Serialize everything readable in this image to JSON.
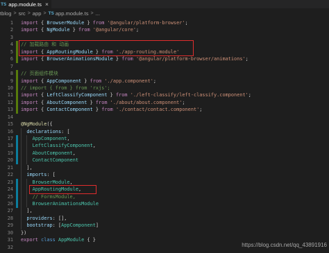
{
  "tab": {
    "icon": "TS",
    "filename": "app.module.ts",
    "close": "×"
  },
  "breadcrumb": {
    "items": [
      "tblog",
      "src",
      "app",
      "app.module.ts",
      "..."
    ],
    "file_icon": "TS",
    "separator": ">"
  },
  "editor": {
    "lines": [
      {
        "n": "1",
        "tokens": [
          {
            "t": "import",
            "k": "kw"
          },
          {
            "t": " { ",
            "k": "p"
          },
          {
            "t": "BrowserModule",
            "k": "v"
          },
          {
            "t": " } ",
            "k": "p"
          },
          {
            "t": "from",
            "k": "kw"
          },
          {
            "t": " ",
            "k": "p"
          },
          {
            "t": "'@angular/platform-browser'",
            "k": "s"
          },
          {
            "t": ";",
            "k": "p"
          }
        ]
      },
      {
        "n": "2",
        "tokens": [
          {
            "t": "import",
            "k": "kw"
          },
          {
            "t": " { ",
            "k": "p"
          },
          {
            "t": "NgModule",
            "k": "v"
          },
          {
            "t": " } ",
            "k": "p"
          },
          {
            "t": "from",
            "k": "kw"
          },
          {
            "t": " ",
            "k": "p"
          },
          {
            "t": "'@angular/core'",
            "k": "s"
          },
          {
            "t": ";",
            "k": "p"
          }
        ]
      },
      {
        "n": "3",
        "tokens": []
      },
      {
        "n": "4",
        "tokens": [
          {
            "t": "// 加载路由 和 动画",
            "k": "c"
          }
        ]
      },
      {
        "n": "5",
        "tokens": [
          {
            "t": "import",
            "k": "kw"
          },
          {
            "t": " { ",
            "k": "p"
          },
          {
            "t": "AppRoutingModule",
            "k": "v"
          },
          {
            "t": " } ",
            "k": "p"
          },
          {
            "t": "from",
            "k": "kw"
          },
          {
            "t": " ",
            "k": "p"
          },
          {
            "t": "'./app-routing.module'",
            "k": "s"
          }
        ]
      },
      {
        "n": "6",
        "tokens": [
          {
            "t": "import",
            "k": "kw"
          },
          {
            "t": " { ",
            "k": "p"
          },
          {
            "t": "BrowserAnimationsModule",
            "k": "v"
          },
          {
            "t": " } ",
            "k": "p"
          },
          {
            "t": "from",
            "k": "kw"
          },
          {
            "t": " ",
            "k": "p"
          },
          {
            "t": "'@angular/platform-browser/animations'",
            "k": "s"
          },
          {
            "t": ";",
            "k": "p"
          }
        ]
      },
      {
        "n": "7",
        "tokens": []
      },
      {
        "n": "8",
        "tokens": [
          {
            "t": "// 页面组件模块",
            "k": "c"
          }
        ]
      },
      {
        "n": "9",
        "tokens": [
          {
            "t": "import",
            "k": "kw"
          },
          {
            "t": " { ",
            "k": "p"
          },
          {
            "t": "AppComponent",
            "k": "v"
          },
          {
            "t": " } ",
            "k": "p"
          },
          {
            "t": "from",
            "k": "kw"
          },
          {
            "t": " ",
            "k": "p"
          },
          {
            "t": "'./app.component'",
            "k": "s"
          },
          {
            "t": ";",
            "k": "p"
          }
        ]
      },
      {
        "n": "10",
        "tokens": [
          {
            "t": "// import { from } from 'rxjs';",
            "k": "c"
          }
        ]
      },
      {
        "n": "11",
        "tokens": [
          {
            "t": "import",
            "k": "kw"
          },
          {
            "t": " { ",
            "k": "p"
          },
          {
            "t": "LeftClassifyComponent",
            "k": "v"
          },
          {
            "t": " } ",
            "k": "p"
          },
          {
            "t": "from",
            "k": "kw"
          },
          {
            "t": " ",
            "k": "p"
          },
          {
            "t": "'./left-classify/left-classify.component'",
            "k": "s"
          },
          {
            "t": ";",
            "k": "p"
          }
        ]
      },
      {
        "n": "12",
        "tokens": [
          {
            "t": "import",
            "k": "kw"
          },
          {
            "t": " { ",
            "k": "p"
          },
          {
            "t": "AboutComponent",
            "k": "v"
          },
          {
            "t": " } ",
            "k": "p"
          },
          {
            "t": "from",
            "k": "kw"
          },
          {
            "t": " ",
            "k": "p"
          },
          {
            "t": "'./about/about.component'",
            "k": "s"
          },
          {
            "t": ";",
            "k": "p"
          }
        ]
      },
      {
        "n": "13",
        "tokens": [
          {
            "t": "import",
            "k": "kw"
          },
          {
            "t": " { ",
            "k": "p"
          },
          {
            "t": "ContactComponent",
            "k": "v"
          },
          {
            "t": " } ",
            "k": "p"
          },
          {
            "t": "from",
            "k": "kw"
          },
          {
            "t": " ",
            "k": "p"
          },
          {
            "t": "'./contact/contact.component'",
            "k": "s"
          },
          {
            "t": ";",
            "k": "p"
          }
        ]
      },
      {
        "n": "14",
        "tokens": []
      },
      {
        "n": "15",
        "tokens": [
          {
            "t": "@NgModule",
            "k": "f"
          },
          {
            "t": "({",
            "k": "p"
          }
        ]
      },
      {
        "n": "16",
        "tokens": [
          {
            "t": "  ",
            "k": "p"
          },
          {
            "t": "declarations",
            "k": "v"
          },
          {
            "t": ": [",
            "k": "p"
          }
        ]
      },
      {
        "n": "17",
        "tokens": [
          {
            "t": "    ",
            "k": "p"
          },
          {
            "t": "AppComponent",
            "k": "cl"
          },
          {
            "t": ",",
            "k": "p"
          }
        ]
      },
      {
        "n": "18",
        "tokens": [
          {
            "t": "    ",
            "k": "p"
          },
          {
            "t": "LeftClassifyComponent",
            "k": "cl"
          },
          {
            "t": ",",
            "k": "p"
          }
        ]
      },
      {
        "n": "19",
        "tokens": [
          {
            "t": "    ",
            "k": "p"
          },
          {
            "t": "AboutComponent",
            "k": "cl"
          },
          {
            "t": ",",
            "k": "p"
          }
        ]
      },
      {
        "n": "20",
        "tokens": [
          {
            "t": "    ",
            "k": "p"
          },
          {
            "t": "ContactComponent",
            "k": "cl"
          }
        ]
      },
      {
        "n": "21",
        "tokens": [
          {
            "t": "  ",
            "k": "p"
          },
          {
            "t": "],",
            "k": "p"
          }
        ]
      },
      {
        "n": "22",
        "tokens": [
          {
            "t": "  ",
            "k": "p"
          },
          {
            "t": "imports",
            "k": "v"
          },
          {
            "t": ": [",
            "k": "p"
          }
        ]
      },
      {
        "n": "23",
        "tokens": [
          {
            "t": "    ",
            "k": "p"
          },
          {
            "t": "BrowserModule",
            "k": "cl"
          },
          {
            "t": ",",
            "k": "p"
          }
        ]
      },
      {
        "n": "24",
        "tokens": [
          {
            "t": "    ",
            "k": "p"
          },
          {
            "t": "AppRoutingModule",
            "k": "cl"
          },
          {
            "t": ",",
            "k": "p"
          }
        ]
      },
      {
        "n": "25",
        "tokens": [
          {
            "t": "    ",
            "k": "p"
          },
          {
            "t": "// FormsModule,",
            "k": "c"
          }
        ]
      },
      {
        "n": "26",
        "tokens": [
          {
            "t": "    ",
            "k": "p"
          },
          {
            "t": "BrowserAnimationsModule",
            "k": "cl"
          }
        ]
      },
      {
        "n": "27",
        "tokens": [
          {
            "t": "  ",
            "k": "p"
          },
          {
            "t": "],",
            "k": "p"
          }
        ]
      },
      {
        "n": "28",
        "tokens": [
          {
            "t": "  ",
            "k": "p"
          },
          {
            "t": "providers",
            "k": "v"
          },
          {
            "t": ": [],",
            "k": "p"
          }
        ]
      },
      {
        "n": "29",
        "tokens": [
          {
            "t": "  ",
            "k": "p"
          },
          {
            "t": "bootstrap",
            "k": "v"
          },
          {
            "t": ": [",
            "k": "p"
          },
          {
            "t": "AppComponent",
            "k": "cl"
          },
          {
            "t": "]",
            "k": "p"
          }
        ]
      },
      {
        "n": "30",
        "tokens": [
          {
            "t": "})",
            "k": "p"
          }
        ]
      },
      {
        "n": "31",
        "tokens": [
          {
            "t": "export",
            "k": "kw"
          },
          {
            "t": " ",
            "k": "p"
          },
          {
            "t": "class",
            "k": "st"
          },
          {
            "t": " ",
            "k": "p"
          },
          {
            "t": "AppModule",
            "k": "cl"
          },
          {
            "t": " { }",
            "k": "p"
          }
        ]
      },
      {
        "n": "32",
        "tokens": []
      }
    ],
    "gutter_marks": [
      {
        "from": 4,
        "to": 6,
        "color": "#587c0c"
      },
      {
        "from": 8,
        "to": 13,
        "color": "#587c0c"
      },
      {
        "from": 17,
        "to": 20,
        "color": "#0c7d9d"
      },
      {
        "from": 23,
        "to": 26,
        "color": "#0c7d9d"
      }
    ]
  },
  "watermark": "https://blog.csdn.net/qq_43891916",
  "icons": {
    "tab_file": "typescript-file-icon",
    "tab_close": "close-icon",
    "breadcrumb_file": "typescript-file-icon",
    "breadcrumb_separator": "chevron-right-icon"
  },
  "colors": {
    "editor_background": "#1e1e1e",
    "tab_bar_background": "#252526",
    "line_number": "#858585",
    "typescript_icon": "#519aba",
    "highlight_box": "#e02d2d",
    "tokens": {
      "kw": "#c586c0",
      "st": "#569cd6",
      "v": "#9cdcfe",
      "s": "#ce9178",
      "c": "#6a9955",
      "cl": "#4ec9b0",
      "f": "#dcdcaa",
      "p": "#d4d4d4"
    }
  }
}
